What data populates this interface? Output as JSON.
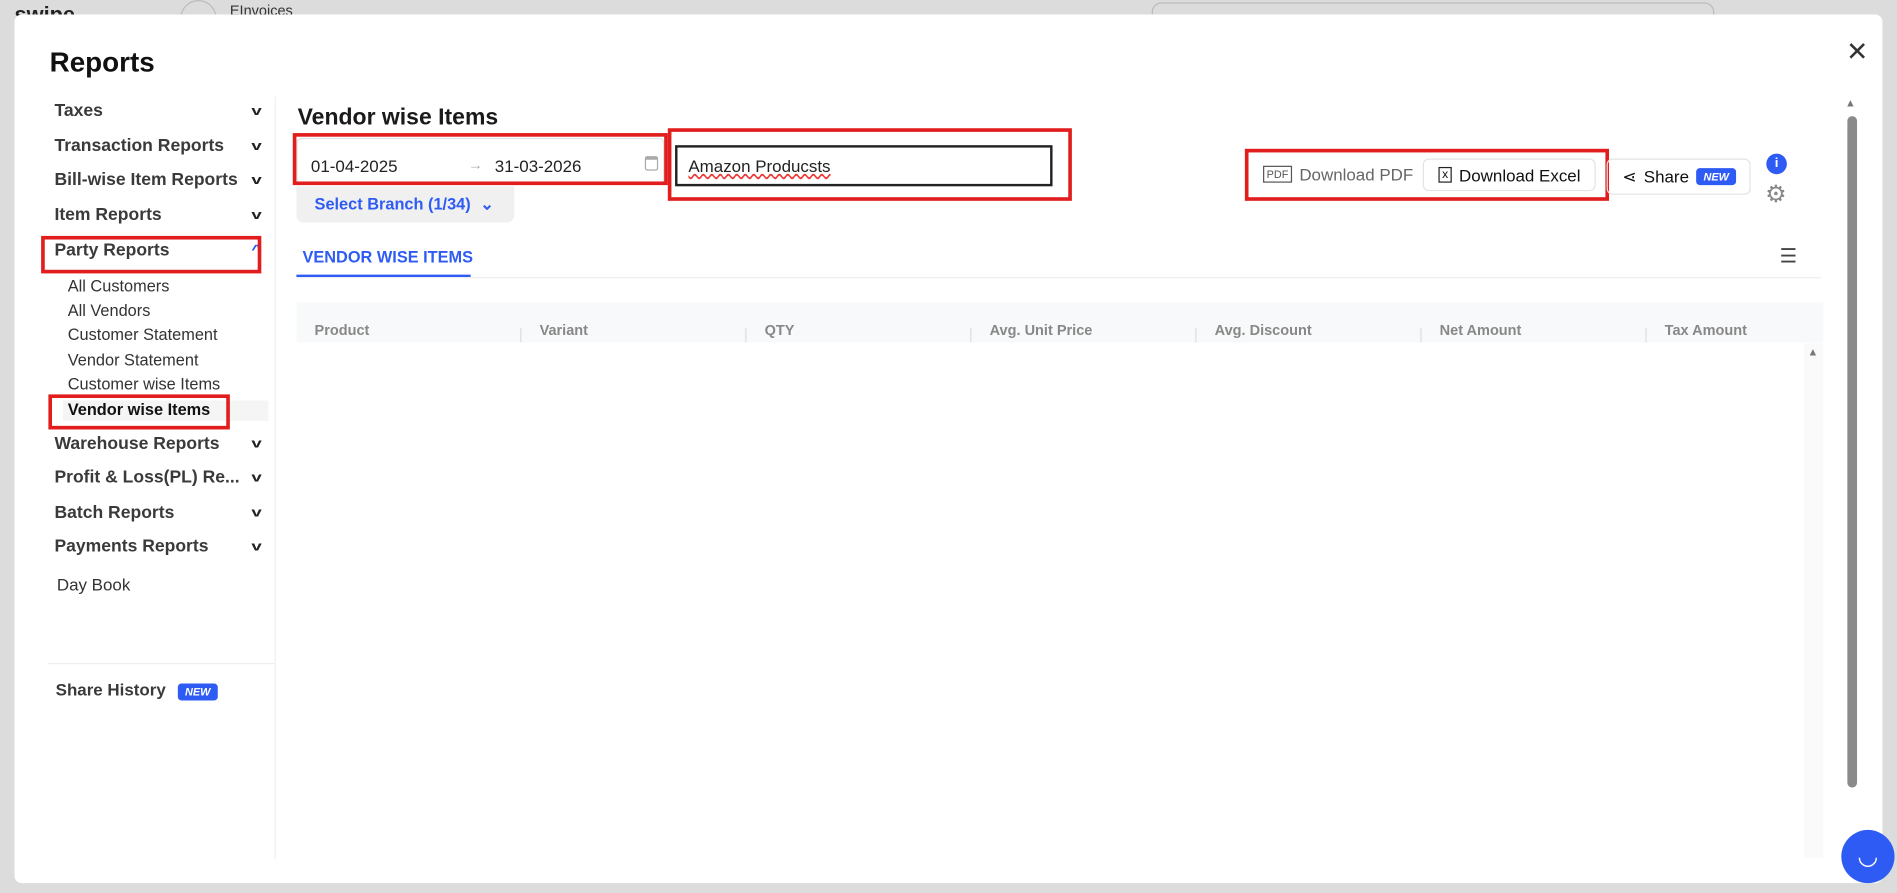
{
  "background": {
    "logo": "swipe",
    "company": "EInvoices"
  },
  "modal": {
    "title": "Reports"
  },
  "sidebar": {
    "groups": [
      {
        "label": "Taxes"
      },
      {
        "label": "Transaction Reports"
      },
      {
        "label": "Bill-wise Item Reports"
      },
      {
        "label": "Item Reports"
      },
      {
        "label": "Party Reports"
      }
    ],
    "party_items": [
      "All Customers",
      "All Vendors",
      "Customer Statement",
      "Vendor Statement",
      "Customer wise Items",
      "Vendor wise Items"
    ],
    "groups2": [
      {
        "label": "Warehouse Reports"
      },
      {
        "label": "Profit & Loss(PL) Re..."
      },
      {
        "label": "Batch Reports"
      },
      {
        "label": "Payments Reports"
      }
    ],
    "day_book": "Day Book",
    "share_history": "Share History",
    "new_badge": "NEW"
  },
  "main": {
    "title": "Vendor wise Items",
    "date_from": "01-04-2025",
    "date_to": "31-03-2026",
    "search_value": "Amazon Producsts",
    "branch": "Select Branch (1/34)",
    "download_pdf": "Download PDF",
    "download_excel": "Download Excel",
    "share": "Share",
    "share_badge": "NEW",
    "tab": "VENDOR WISE ITEMS",
    "columns": [
      "Product",
      "Variant",
      "QTY",
      "Avg. Unit Price",
      "Avg. Discount",
      "Net Amount",
      "Tax Amount"
    ]
  },
  "colors": {
    "accent": "#2f5bf5",
    "annotation": "#e11d1d"
  }
}
